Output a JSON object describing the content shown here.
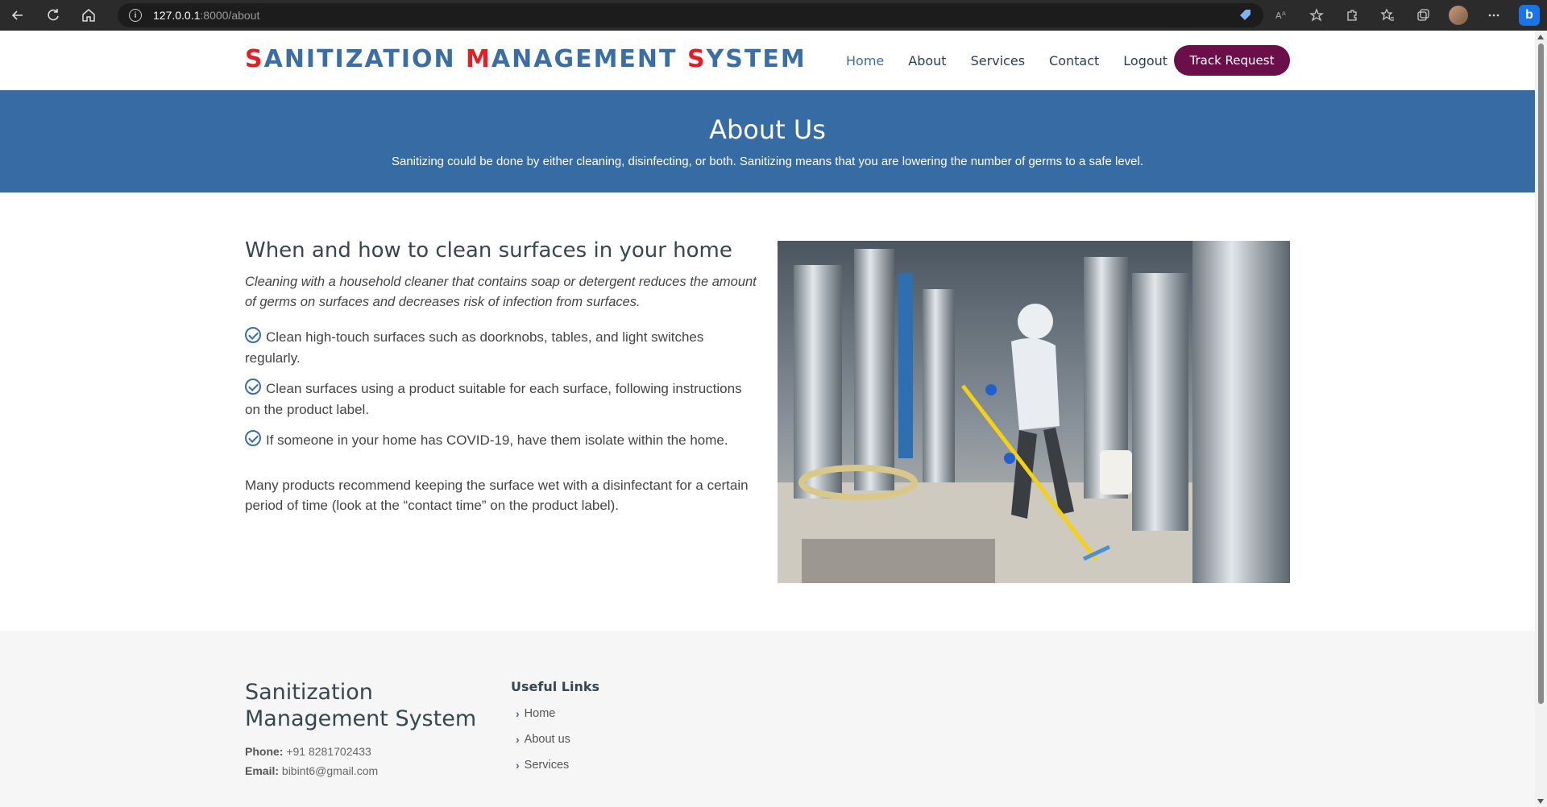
{
  "browser": {
    "url_host": "127.0.0.1",
    "url_rest": ":8000/about"
  },
  "header": {
    "logo": [
      {
        "first": "S",
        "rest": "ANITIZATION "
      },
      {
        "first": "M",
        "rest": "ANAGEMENT "
      },
      {
        "first": "S",
        "rest": "YSTEM"
      }
    ],
    "nav": [
      "Home",
      "About",
      "Services",
      "Contact",
      "Logout"
    ],
    "track_button": "Track Request"
  },
  "banner": {
    "title": "About Us",
    "subtitle": "Sanitizing could be done by either cleaning, disinfecting, or both. Sanitizing means that you are lowering the number of germs to a safe level."
  },
  "main": {
    "heading": "When and how to clean surfaces in your home",
    "lead": "Cleaning with a household cleaner that contains soap or detergent reduces the amount of germs on surfaces and decreases risk of infection from surfaces.",
    "list": [
      "Clean high-touch surfaces such as doorknobs, tables, and light switches regularly.",
      "Clean surfaces using a product suitable for each surface, following instructions on the product label.",
      "If someone in your home has COVID-19, have them isolate within the home."
    ],
    "closing": "Many products recommend keeping the surface wet with a disinfectant for a certain period of time (look at the “contact time” on the product label)."
  },
  "footer": {
    "brand": "Sanitization Management System",
    "phone_label": "Phone:",
    "phone": "+91 8281702433",
    "email_label": "Email:",
    "email": "bibint6@gmail.com",
    "useful_title": "Useful Links",
    "links": [
      "Home",
      "About us",
      "Services"
    ]
  },
  "colors": {
    "brand_blue": "#376ba3",
    "logo_red": "#e31e24",
    "button_purple": "#6b0f4a"
  }
}
